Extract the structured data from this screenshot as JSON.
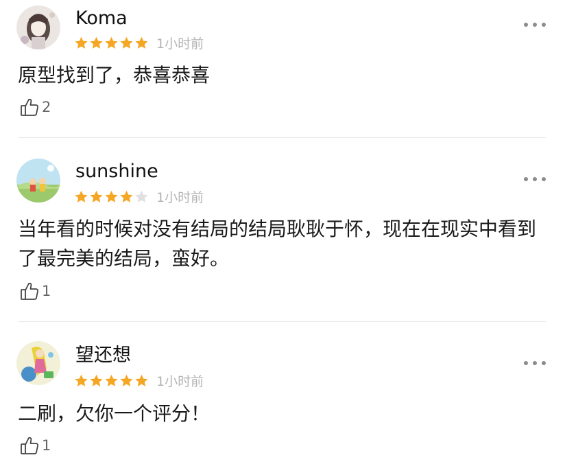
{
  "colors": {
    "star_filled": "#f5a623",
    "star_empty": "#e0e0e0",
    "time_text": "#b3b3b3",
    "divider": "#e8e8e8"
  },
  "comments": [
    {
      "username": "Koma",
      "rating": 5,
      "max_rating": 5,
      "time": "1小时前",
      "text": "原型找到了，恭喜恭喜",
      "likes": "2",
      "like_icon": "thumbs-up-icon",
      "more_icon": "more-dots-icon"
    },
    {
      "username": "sunshine",
      "rating": 4,
      "max_rating": 5,
      "time": "1小时前",
      "text": "当年看的时候对没有结局的结局耿耿于怀，现在在现实中看到了最完美的结局，蛮好。",
      "likes": "1",
      "like_icon": "thumbs-up-icon",
      "more_icon": "more-dots-icon"
    },
    {
      "username": "望还想",
      "rating": 5,
      "max_rating": 5,
      "time": "1小时前",
      "text": "二刷，欠你一个评分！",
      "likes": "1",
      "like_icon": "thumbs-up-icon",
      "more_icon": "more-dots-icon"
    }
  ]
}
